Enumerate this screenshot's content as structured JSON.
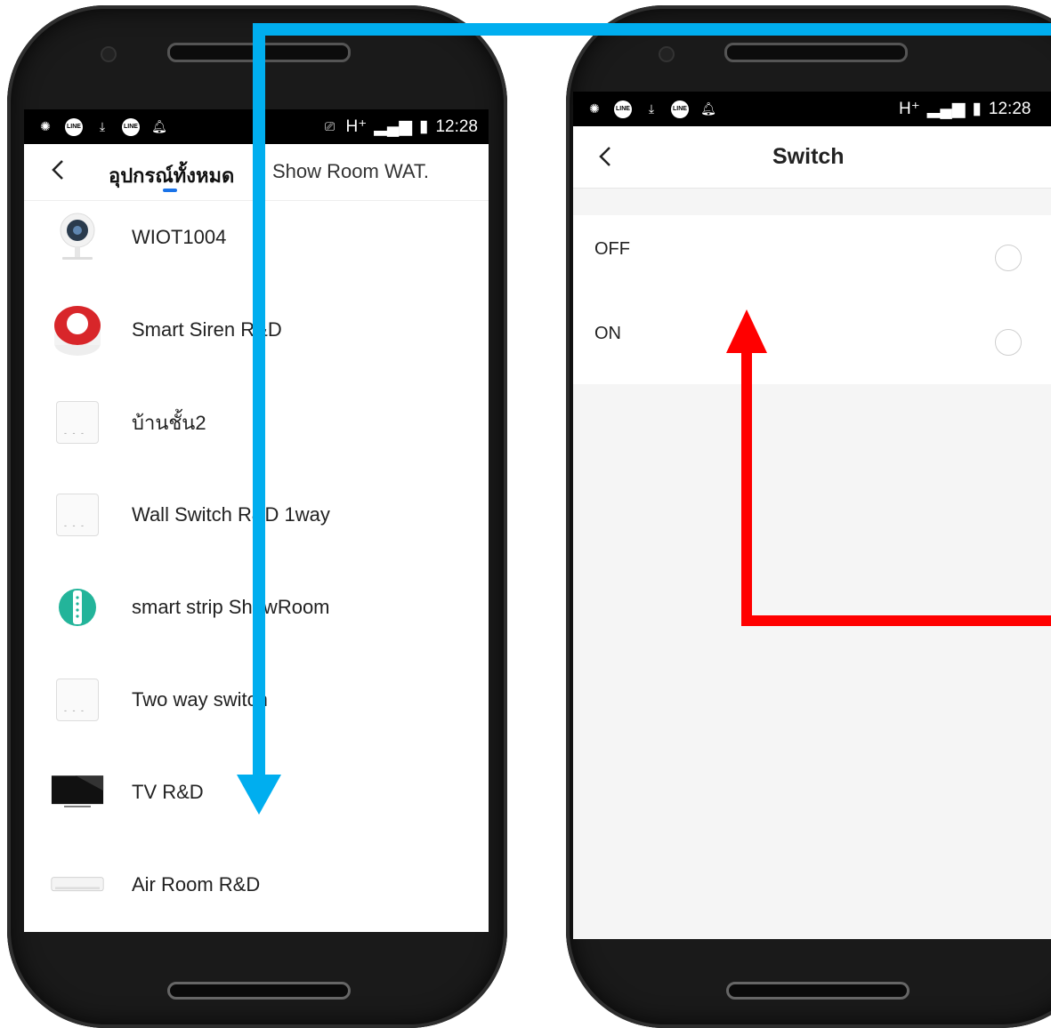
{
  "left_screen": {
    "status_bar": {
      "network": "H⁺",
      "time": "12:28"
    },
    "tabs": [
      {
        "label": "อุปกรณ์ทั้งหมด",
        "active": true
      },
      {
        "label": "Show Room WAT.",
        "active": false
      }
    ],
    "devices": [
      {
        "name": "WIOT1004",
        "icon": "camera-icon"
      },
      {
        "name": "Smart Siren R&D",
        "icon": "siren-icon"
      },
      {
        "name": "บ้านชั้น2",
        "icon": "wall-switch-icon"
      },
      {
        "name": "Wall Switch R&D 1way",
        "icon": "wall-switch-icon"
      },
      {
        "name": "smart strip ShowRoom",
        "icon": "power-strip-icon"
      },
      {
        "name": "Two way switch",
        "icon": "wall-switch-icon"
      },
      {
        "name": "TV R&D",
        "icon": "tv-icon"
      },
      {
        "name": "Air Room R&D",
        "icon": "air-conditioner-icon"
      }
    ]
  },
  "right_screen": {
    "status_bar": {
      "network": "H⁺",
      "time": "12:28"
    },
    "title": "Switch",
    "options": [
      {
        "label": "OFF",
        "selected": false
      },
      {
        "label": "ON",
        "selected": false
      }
    ]
  },
  "colors": {
    "blue_arrow": "#00aeef",
    "red_arrow": "#ff0000",
    "tab_indicator": "#1a73e8"
  }
}
